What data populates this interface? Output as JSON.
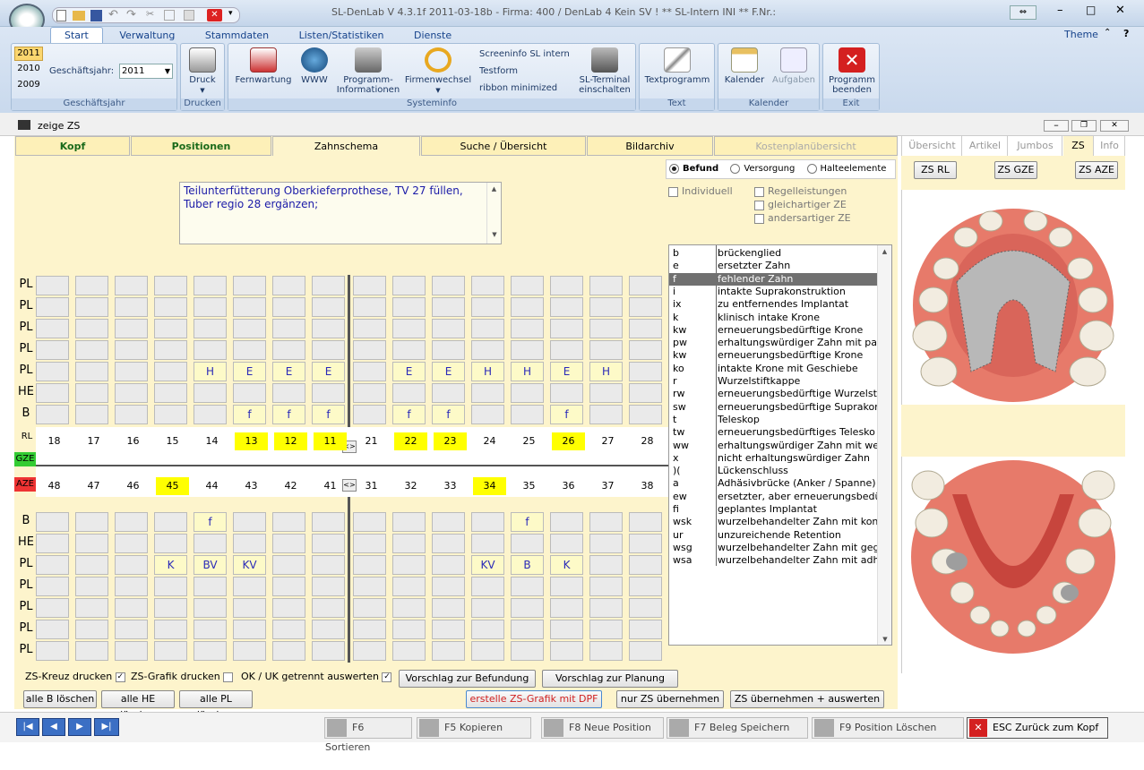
{
  "window": {
    "title": "SL-DenLab V 4.3.1f 2011-03-18b - Firma: 400 / DenLab 4 Kein SV ! ** SL-Intern INI **  F.Nr.:",
    "theme": "Theme",
    "help": "?"
  },
  "ribbon": {
    "tabs": [
      "Start",
      "Verwaltung",
      "Stammdaten",
      "Listen/Statistiken",
      "Dienste"
    ],
    "years": [
      "2011",
      "2010",
      "2009"
    ],
    "gj_label": "Geschäftsjahr:",
    "gj_value": "2011",
    "groups": [
      "Geschäftsjahr",
      "Drucken",
      "Systeminfo",
      "Text",
      "Kalender",
      "Exit"
    ],
    "druck": "Druck",
    "fernwartung": "Fernwartung",
    "www": "WWW",
    "programm_info": "Programm-\nInformationen",
    "firmenwechsel": "Firmenwechsel",
    "screeninfo": "Screeninfo SL intern",
    "testform": "Testform",
    "ribbon_min": "ribbon minimized",
    "sl_terminal": "SL-Terminal\neinschalten",
    "textprogramm": "Textprogramm",
    "kalender": "Kalender",
    "aufgaben": "Aufgaben",
    "beenden": "Programm\nbeenden"
  },
  "doc": {
    "title": "zeige ZS"
  },
  "tabs": [
    "Kopf",
    "Positionen",
    "Zahnschema",
    "Suche / Übersicht",
    "Bildarchiv",
    "Kostenplanübersicht"
  ],
  "right_tabs": [
    "Übersicht",
    "Artikel",
    "Jumbos",
    "ZS",
    "Info"
  ],
  "right_buttons": [
    "ZS RL",
    "ZS GZE",
    "ZS AZE"
  ],
  "note": "Teilunterfütterung Oberkieferprothese, TV 27 füllen, Tuber regio 28 ergänzen;",
  "radios": [
    "Befund",
    "Versorgung",
    "Halteelemente"
  ],
  "checks": {
    "individuell": "Individuell",
    "regel": "Regelleistungen",
    "gleich": "gleichartiger ZE",
    "anders": "andersartiger ZE"
  },
  "upper_rows": [
    {
      "label": "PL",
      "cells": [
        "",
        "",
        "",
        "",
        "",
        "",
        "",
        "",
        "",
        "",
        "",
        "",
        "",
        "",
        "",
        ""
      ]
    },
    {
      "label": "PL",
      "cells": [
        "",
        "",
        "",
        "",
        "",
        "",
        "",
        "",
        "",
        "",
        "",
        "",
        "",
        "",
        "",
        ""
      ]
    },
    {
      "label": "PL",
      "cells": [
        "",
        "",
        "",
        "",
        "",
        "",
        "",
        "",
        "",
        "",
        "",
        "",
        "",
        "",
        "",
        ""
      ]
    },
    {
      "label": "PL",
      "cells": [
        "",
        "",
        "",
        "",
        "",
        "",
        "",
        "",
        "",
        "",
        "",
        "",
        "",
        "",
        "",
        ""
      ]
    },
    {
      "label": "PL",
      "cells": [
        "",
        "",
        "",
        "",
        "H",
        "E",
        "E",
        "E",
        "",
        "E",
        "E",
        "H",
        "H",
        "E",
        "H",
        ""
      ]
    },
    {
      "label": "HE",
      "cells": [
        "",
        "",
        "",
        "",
        "",
        "",
        "",
        "",
        "",
        "",
        "",
        "",
        "",
        "",
        "",
        ""
      ]
    },
    {
      "label": "B",
      "cells": [
        "",
        "",
        "",
        "",
        "",
        "f",
        "f",
        "f",
        "",
        "f",
        "f",
        "",
        "",
        "f",
        "",
        ""
      ]
    }
  ],
  "lower_rows": [
    {
      "label": "B",
      "cells": [
        "",
        "",
        "",
        "",
        "f",
        "",
        "",
        "",
        "",
        "",
        "",
        "",
        "f",
        "",
        "",
        ""
      ]
    },
    {
      "label": "HE",
      "cells": [
        "",
        "",
        "",
        "",
        "",
        "",
        "",
        "",
        "",
        "",
        "",
        "",
        "",
        "",
        "",
        ""
      ]
    },
    {
      "label": "PL",
      "cells": [
        "",
        "",
        "",
        "K",
        "BV",
        "KV",
        "",
        "",
        "",
        "",
        "",
        "KV",
        "B",
        "K",
        "",
        ""
      ]
    },
    {
      "label": "PL",
      "cells": [
        "",
        "",
        "",
        "",
        "",
        "",
        "",
        "",
        "",
        "",
        "",
        "",
        "",
        "",
        "",
        ""
      ]
    },
    {
      "label": "PL",
      "cells": [
        "",
        "",
        "",
        "",
        "",
        "",
        "",
        "",
        "",
        "",
        "",
        "",
        "",
        "",
        "",
        ""
      ]
    },
    {
      "label": "PL",
      "cells": [
        "",
        "",
        "",
        "",
        "",
        "",
        "",
        "",
        "",
        "",
        "",
        "",
        "",
        "",
        "",
        ""
      ]
    },
    {
      "label": "PL",
      "cells": [
        "",
        "",
        "",
        "",
        "",
        "",
        "",
        "",
        "",
        "",
        "",
        "",
        "",
        "",
        "",
        ""
      ]
    }
  ],
  "teeth_upper": [
    "18",
    "17",
    "16",
    "15",
    "14",
    "13",
    "12",
    "11",
    "21",
    "22",
    "23",
    "24",
    "25",
    "26",
    "27",
    "28"
  ],
  "teeth_lower": [
    "48",
    "47",
    "46",
    "45",
    "44",
    "43",
    "42",
    "41",
    "31",
    "32",
    "33",
    "34",
    "35",
    "36",
    "37",
    "38"
  ],
  "labels": {
    "rl": "RL",
    "gze": "GZE",
    "aze": "AZE",
    "swap": "<>"
  },
  "codes": [
    [
      "b",
      "brückenglied"
    ],
    [
      "e",
      "ersetzter Zahn"
    ],
    [
      "f",
      "fehlender Zahn"
    ],
    [
      "i",
      "intakte Suprakonstruktion"
    ],
    [
      "ix",
      "zu entfernendes Implantat"
    ],
    [
      "k",
      "klinisch intake Krone"
    ],
    [
      "kw",
      "erneuerungsbedürftige Krone"
    ],
    [
      "pw",
      "erhaltungswürdiger Zahn mit par"
    ],
    [
      "kw",
      "erneuerungsbedürftige Krone"
    ],
    [
      "ko",
      "intakte Krone mit Geschiebe"
    ],
    [
      "r",
      "Wurzelstiftkappe"
    ],
    [
      "rw",
      "erneuerungsbedürftige Wurzelst"
    ],
    [
      "sw",
      "erneuerungsbedürftige Suprakor"
    ],
    [
      "t",
      "Teleskop"
    ],
    [
      "tw",
      "erneuerungsbedürftiges Telesko"
    ],
    [
      "ww",
      "erhaltungswürdiger Zahn mit we"
    ],
    [
      "x",
      "nicht erhaltungswürdiger Zahn"
    ],
    [
      ")(",
      "Lückenschluss"
    ],
    [
      "a",
      "Adhäsivbrücke (Anker / Spanne)"
    ],
    [
      "ew",
      "ersetzter, aber erneuerungsbedü"
    ],
    [
      "fi",
      "geplantes Implantat"
    ],
    [
      "wsk",
      "wurzelbehandelter Zahn mit kont"
    ],
    [
      "ur",
      "unzureichende Retention"
    ],
    [
      "wsg",
      "wurzelbehandelter Zahn mit geg"
    ],
    [
      "wsa",
      "wurzelbehandelter Zahn mit adh"
    ]
  ],
  "bottom": {
    "zs_kreuz": "ZS-Kreuz drucken",
    "zs_grafik": "ZS-Grafik drucken",
    "okuk": "OK / UK getrennt auswerten",
    "vorschlag_bef": "Vorschlag zur Befundung",
    "vorschlag_plan": "Vorschlag zur Planung",
    "del_b": "alle B löschen",
    "del_he": "alle HE löscher",
    "del_pl": "alle PL löschen",
    "erstelle": "erstelle ZS-Grafik mit DPF",
    "nur_zs": "nur ZS übernehmen",
    "zs_ausw": "ZS übernehmen + auswerten"
  },
  "footer": {
    "f6": "F6 Sortieren",
    "f5": "F5 Kopieren",
    "f8": "F8 Neue Position",
    "f7": "F7 Beleg Speichern",
    "f9": "F9 Position Löschen",
    "esc": "ESC Zurück zum Kopf"
  },
  "colors": {
    "accent": "#15428b",
    "yellow": "#ffff00",
    "panel": "#fdf4cc",
    "selected": "#707070",
    "gze": "#33cc33",
    "aze": "#ee3333"
  }
}
